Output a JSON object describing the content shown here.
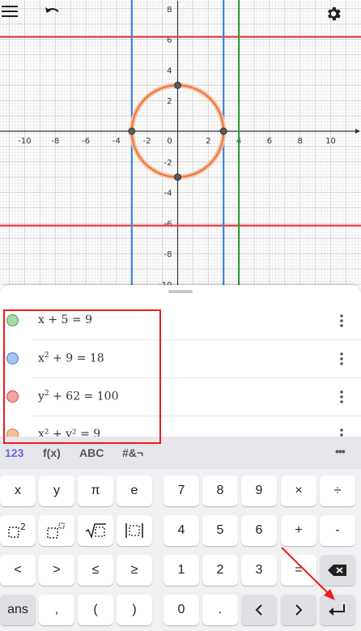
{
  "graph": {
    "x_tick_labels": [
      "-10",
      "-8",
      "-6",
      "-4",
      "-2",
      "0",
      "2",
      "4",
      "6",
      "8",
      "10"
    ],
    "y_tick_labels": [
      "8",
      "6",
      "4",
      "2",
      "-2",
      "-4",
      "-6",
      "-8",
      "-10"
    ],
    "colors": {
      "red": "#e0393e",
      "blue": "#3d7fd6",
      "green": "#2e9c3a",
      "orange": "#e8763a",
      "point": "#5a5a5a"
    }
  },
  "toolbar": {
    "menu_icon": "hamburger-menu-icon",
    "undo_icon": "undo-icon",
    "settings_icon": "gear-icon"
  },
  "algebra": {
    "rows": [
      {
        "color": "#a6d9a6",
        "border": "#4a9b4a",
        "lhs": "x + 5",
        "rhs": "9"
      },
      {
        "color": "#a7c4f0",
        "border": "#4a78c8",
        "lhs_base": "x",
        "lhs_exp": "2",
        "lhs_rest": " + 9",
        "rhs": "18"
      },
      {
        "color": "#f2a6a6",
        "border": "#c84a4a",
        "lhs_base": "y",
        "lhs_exp": "2",
        "lhs_rest": " + 62",
        "rhs": "100"
      },
      {
        "color": "#f5c29a",
        "border": "#d27a3a",
        "expr": "x² + y² = 9"
      }
    ]
  },
  "keyboard": {
    "tabs": [
      "123",
      "f(x)",
      "ABC",
      "#&¬"
    ],
    "more": "•••",
    "rows": [
      [
        "x",
        "y",
        "π",
        "e",
        "7",
        "8",
        "9",
        "×",
        "÷"
      ],
      [
        "□²",
        "□⬚",
        "√□",
        "|□|",
        "4",
        "5",
        "6",
        "+",
        "-"
      ],
      [
        "<",
        ">",
        "≤",
        "≥",
        "1",
        "2",
        "3",
        "=",
        "⌫"
      ],
      [
        "ans",
        ",",
        "(",
        ")",
        "0",
        ".",
        "‹",
        "›",
        "↵"
      ]
    ]
  }
}
